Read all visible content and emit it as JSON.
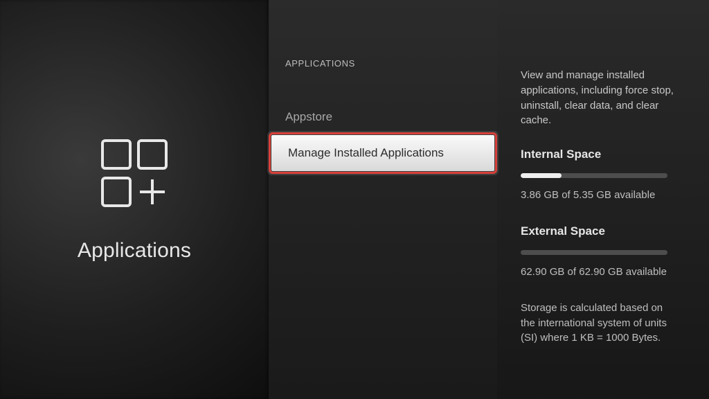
{
  "left": {
    "title": "Applications"
  },
  "mid": {
    "header": "APPLICATIONS",
    "items": [
      {
        "label": "Appstore",
        "selected": false
      },
      {
        "label": "Manage Installed Applications",
        "selected": true
      }
    ]
  },
  "right": {
    "description": "View and manage installed applications, including force stop, uninstall, clear data, and clear cache.",
    "internal": {
      "title": "Internal Space",
      "available_gb": 3.86,
      "total_gb": 5.35,
      "text": "3.86 GB of 5.35 GB available",
      "used_pct": 28
    },
    "external": {
      "title": "External Space",
      "available_gb": 62.9,
      "total_gb": 62.9,
      "text": "62.90 GB of 62.90 GB available",
      "used_pct": 0
    },
    "note": "Storage is calculated based on the international system of units (SI) where 1 KB = 1000 Bytes."
  }
}
